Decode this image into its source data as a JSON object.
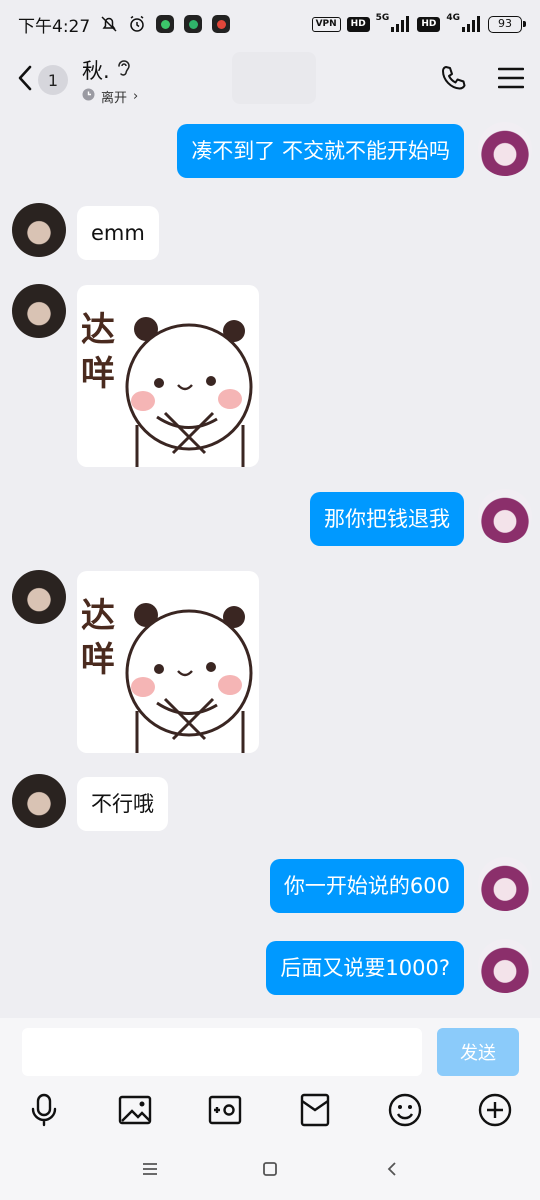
{
  "status_bar": {
    "time": "下午4:27",
    "vpn": "VPN",
    "hd1": "HD",
    "net1": "5G",
    "hd2": "HD",
    "net2": "4G",
    "battery": "93"
  },
  "header": {
    "unread_count": "1",
    "contact_name": "秋.",
    "status": "离开",
    "status_chevron": "›"
  },
  "messages": [
    {
      "side": "self",
      "type": "text",
      "text": "凑不到了 不交就不能开始吗"
    },
    {
      "side": "other",
      "type": "text",
      "text": "emm"
    },
    {
      "side": "other",
      "type": "sticker",
      "sticker_text": "达咩"
    },
    {
      "side": "self",
      "type": "text",
      "text": "那你把钱退我"
    },
    {
      "side": "other",
      "type": "sticker",
      "sticker_text": "达咩"
    },
    {
      "side": "other",
      "type": "text",
      "text": "不行哦"
    },
    {
      "side": "self",
      "type": "text",
      "text": "你一开始说的600"
    },
    {
      "side": "self",
      "type": "text",
      "text": "后面又说要1000?"
    }
  ],
  "composer": {
    "input_value": "",
    "input_placeholder": "",
    "send_label": "发送"
  },
  "toolbar_icons": [
    "mic-icon",
    "image-icon",
    "camera-icon",
    "red-packet-icon",
    "emoji-icon",
    "plus-icon"
  ],
  "nav_icons": [
    "menu-icon",
    "home-icon",
    "back-icon"
  ],
  "colors": {
    "self_bubble": "#0099FF",
    "other_bubble": "#FFFFFF",
    "background": "#EEEEF2",
    "send_disabled": "#8BCBFA"
  }
}
